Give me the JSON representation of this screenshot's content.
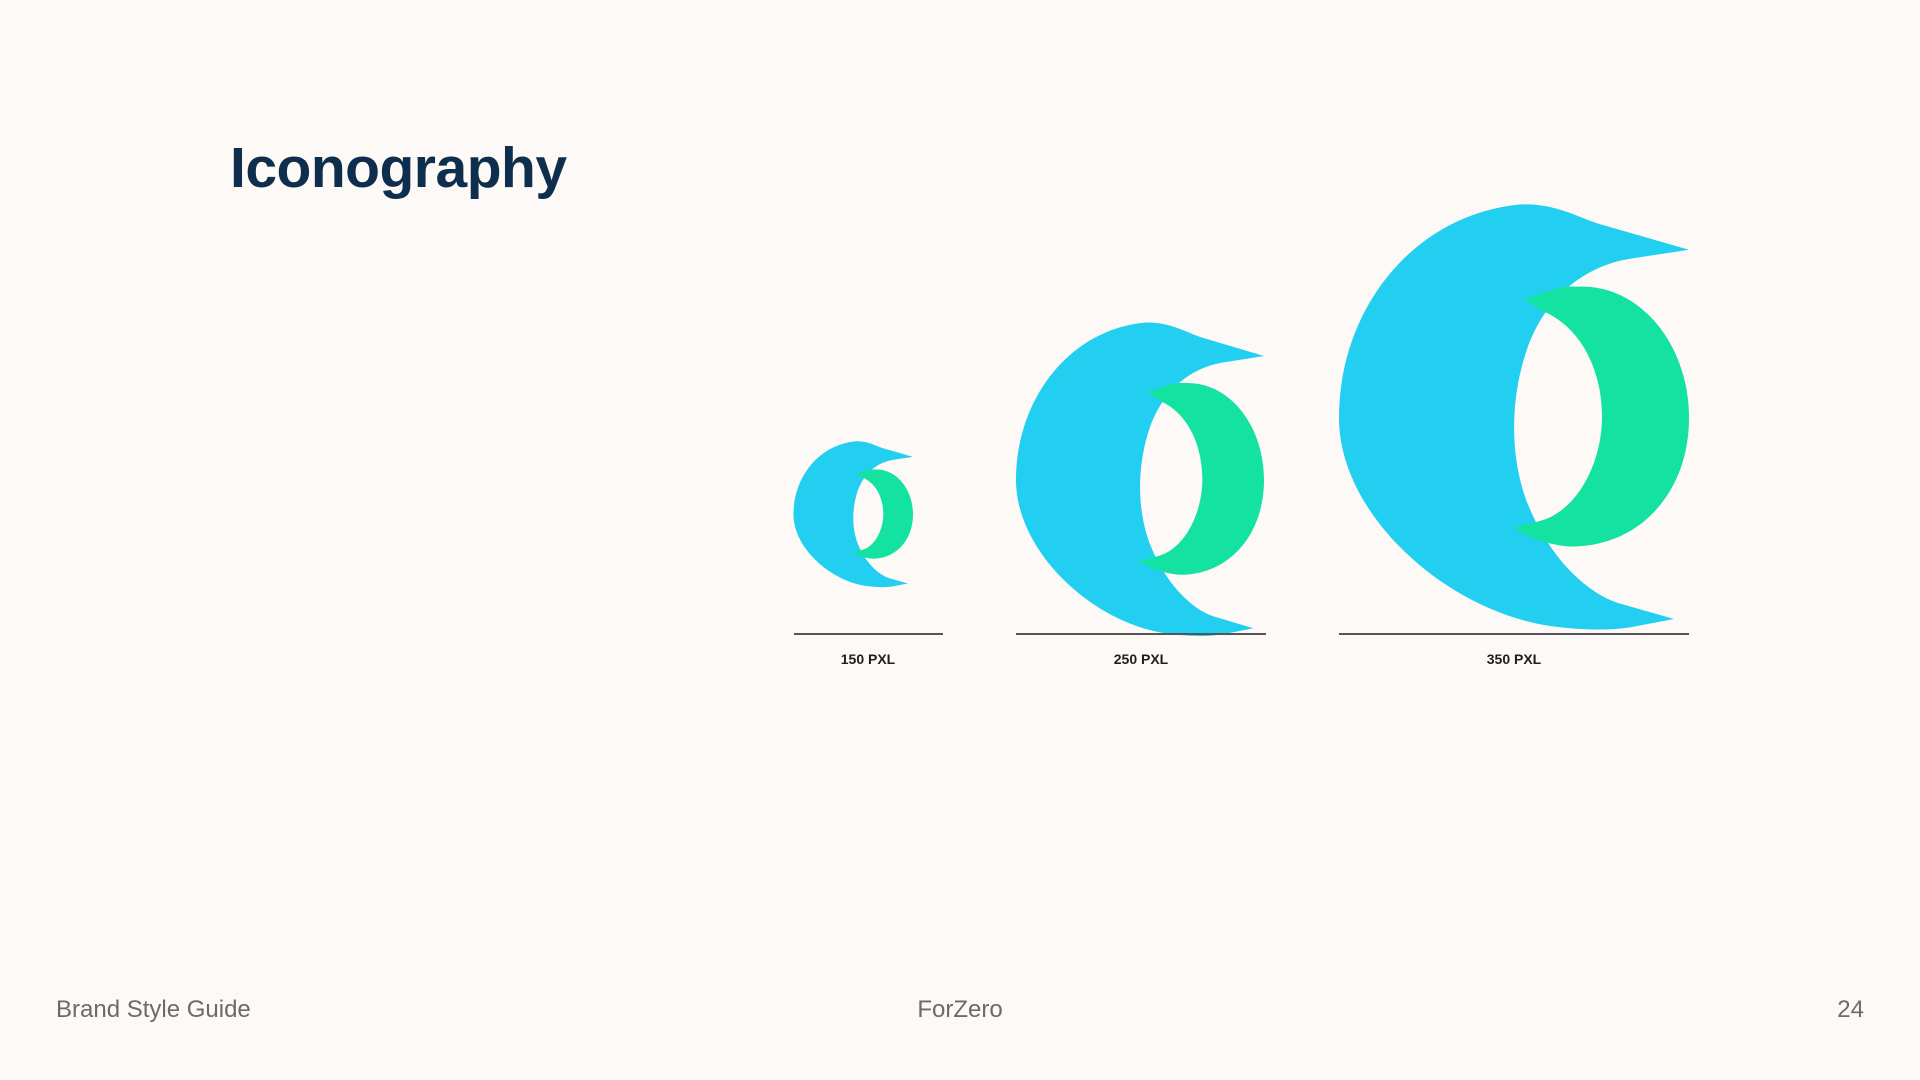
{
  "slide": {
    "title": "Iconography"
  },
  "logo_sizes": [
    {
      "label": "150 PXL"
    },
    {
      "label": "250 PXL"
    },
    {
      "label": "350 PXL"
    }
  ],
  "colors": {
    "background": "#fcf9f7",
    "title": "#0e2e4d",
    "logo_blue": "#22cff0",
    "logo_green": "#14e2a0",
    "rule": "#555555",
    "footer_text": "#6b6b6b"
  },
  "footer": {
    "left": "Brand Style Guide",
    "center": "ForZero",
    "page_number": "24"
  }
}
